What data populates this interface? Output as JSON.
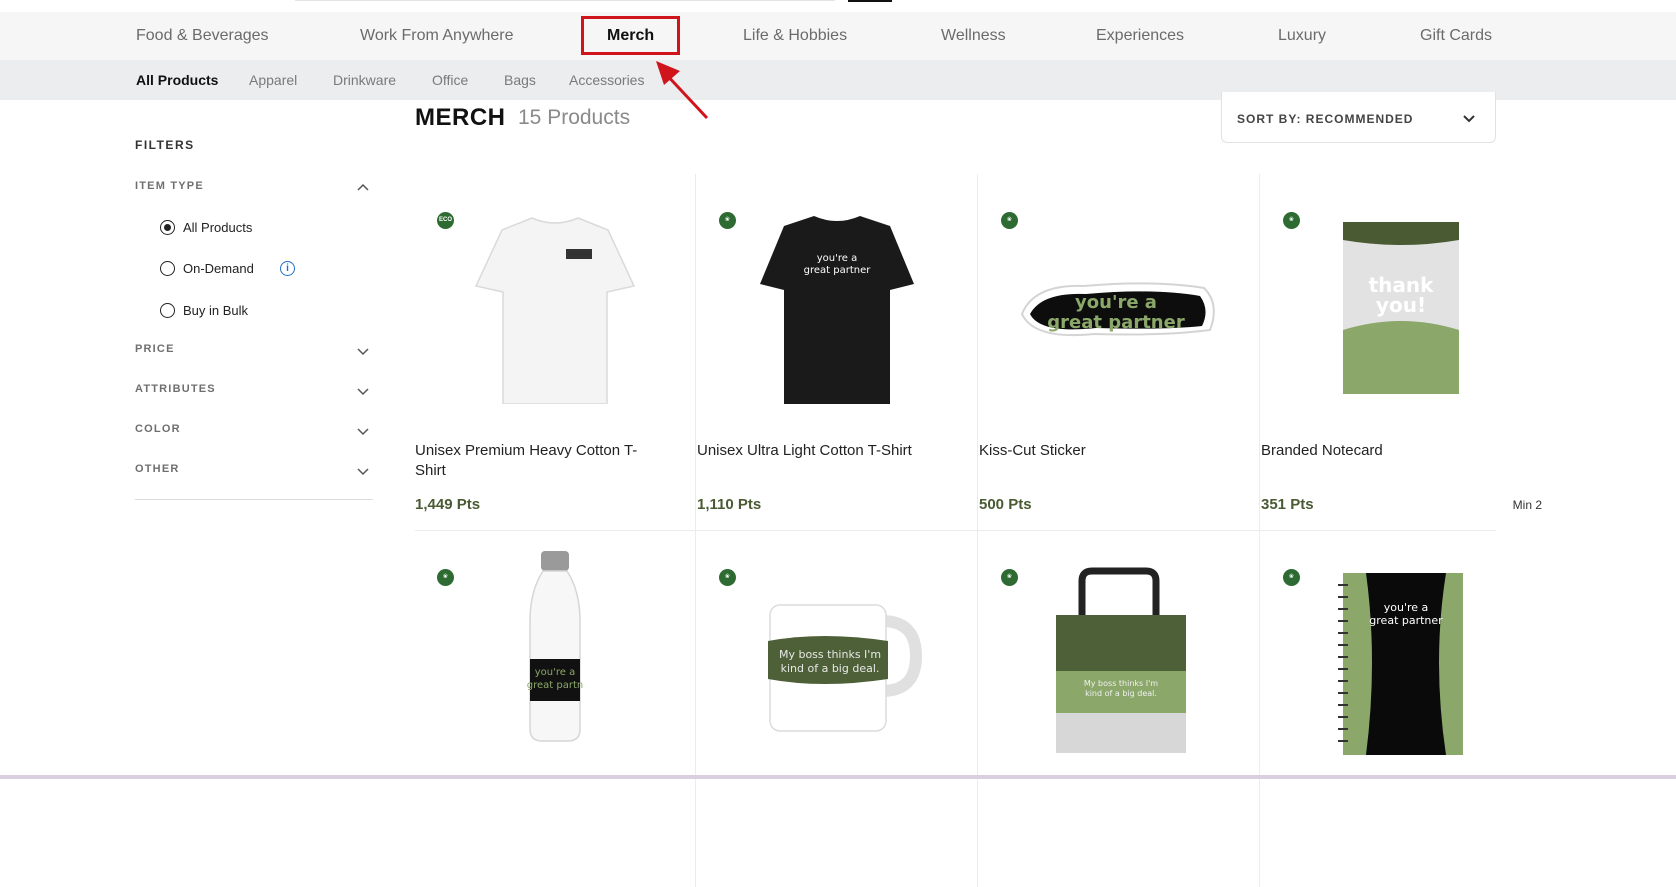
{
  "category_nav": {
    "items": [
      {
        "label": "Food & Beverages"
      },
      {
        "label": "Work From Anywhere"
      },
      {
        "label": "Merch",
        "active": true
      },
      {
        "label": "Life & Hobbies"
      },
      {
        "label": "Wellness"
      },
      {
        "label": "Experiences"
      },
      {
        "label": "Luxury"
      },
      {
        "label": "Gift Cards"
      }
    ]
  },
  "sub_nav": {
    "items": [
      {
        "label": "All Products",
        "active": true
      },
      {
        "label": "Apparel"
      },
      {
        "label": "Drinkware"
      },
      {
        "label": "Office"
      },
      {
        "label": "Bags"
      },
      {
        "label": "Accessories"
      }
    ]
  },
  "filters": {
    "title": "FILTERS",
    "item_type": {
      "label": "ITEM TYPE",
      "options": [
        {
          "label": "All Products",
          "selected": true
        },
        {
          "label": "On-Demand",
          "info_icon": "info-icon"
        },
        {
          "label": "Buy in Bulk"
        }
      ]
    },
    "sections": [
      {
        "label": "PRICE"
      },
      {
        "label": "ATTRIBUTES"
      },
      {
        "label": "COLOR"
      },
      {
        "label": "OTHER"
      }
    ]
  },
  "page": {
    "title": "MERCH",
    "count": "15 Products"
  },
  "sort": {
    "label": "SORT BY: RECOMMENDED"
  },
  "products": [
    {
      "name": "Unisex Premium Heavy Cotton T-Shirt",
      "price": "1,449 Pts",
      "badge": "ECO",
      "image": "white-tshirt"
    },
    {
      "name": "Unisex Ultra Light Cotton T-Shirt",
      "price": "1,110 Pts",
      "badge": "leaf",
      "image": "black-tshirt",
      "image_text": "you're a great partner"
    },
    {
      "name": "Kiss-Cut Sticker",
      "price": "500 Pts",
      "badge": "leaf",
      "image": "sticker",
      "image_text": "you're a great partner"
    },
    {
      "name": "Branded Notecard",
      "price": "351 Pts",
      "min": "Min 2",
      "badge": "leaf",
      "image": "notecard",
      "image_text": "thank you!"
    },
    {
      "badge": "leaf",
      "image": "water-bottle",
      "image_text": "you're a great partner"
    },
    {
      "badge": "leaf",
      "image": "mug",
      "image_text": "My boss thinks I'm kind of a big deal."
    },
    {
      "badge": "leaf",
      "image": "tote-bag",
      "image_text": "My boss thinks I'm kind of a big deal."
    },
    {
      "badge": "leaf",
      "image": "notebook",
      "image_text": "you're a great partner"
    }
  ],
  "colors": {
    "accent_price": "#4a5b33",
    "eco_badge": "#2e6b33",
    "highlight": "#d0141c",
    "product_green": "#8ba86a"
  }
}
